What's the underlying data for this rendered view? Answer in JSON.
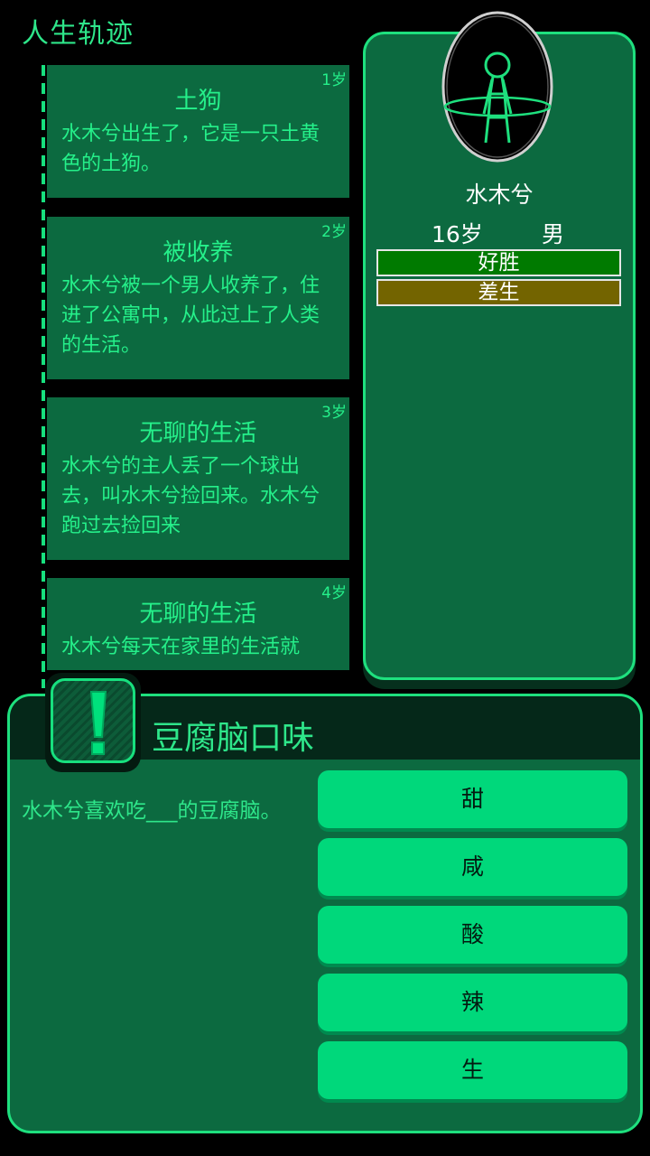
{
  "header": {
    "title": "人生轨迹"
  },
  "timeline": [
    {
      "age": "1岁",
      "title": "土狗",
      "text": "水木兮出生了，它是一只土黄色的土狗。"
    },
    {
      "age": "2岁",
      "title": "被收养",
      "text": "水木兮被一个男人收养了，住进了公寓中，从此过上了人类的生活。"
    },
    {
      "age": "3岁",
      "title": "无聊的生活",
      "text": "水木兮的主人丢了一个球出去，叫水木兮捡回来。水木兮跑过去捡回来"
    },
    {
      "age": "4岁",
      "title": "无聊的生活",
      "text": "水木兮每天在家里的生活就"
    }
  ],
  "profile": {
    "name": "水木兮",
    "age": "16岁",
    "gender": "男",
    "traits": [
      {
        "label": "好胜",
        "color": "#007a00"
      },
      {
        "label": "差生",
        "color": "#736400"
      }
    ]
  },
  "dialog": {
    "title": "豆腐脑口味",
    "question": "水木兮喜欢吃___的豆腐脑。",
    "options": [
      "甜",
      "咸",
      "酸",
      "辣",
      "生"
    ]
  },
  "icons": {
    "alert": "exclamation-icon",
    "avatar": "stick-figure-egg-icon"
  },
  "colors": {
    "accent": "#1ee07e",
    "panel": "#0c6a40",
    "button": "#00d87b"
  }
}
